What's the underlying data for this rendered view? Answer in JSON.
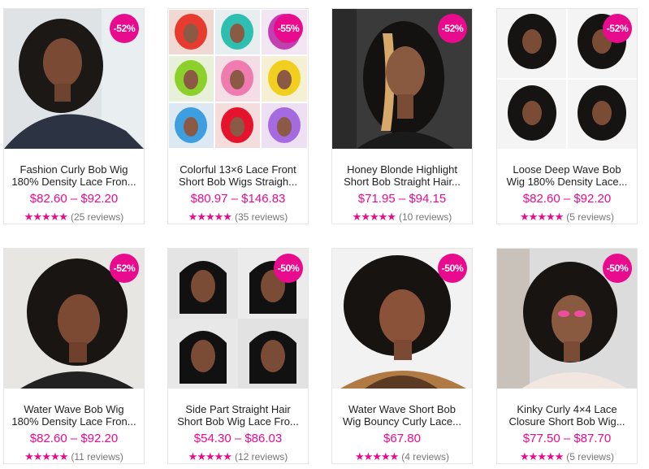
{
  "products": [
    {
      "title_line1": "Fashion Curly Bob Wig",
      "title_line2": "180% Density Lace Fron...",
      "price": "$82.60 – $92.20",
      "discount": "-52%",
      "stars": "★★★★★",
      "reviews": "(25 reviews)"
    },
    {
      "title_line1": "Colorful 13×6 Lace Front",
      "title_line2": "Short Bob Wigs Straigh...",
      "price": "$80.97 – $146.83",
      "discount": "-55%",
      "stars": "★★★★★",
      "reviews": "(35 reviews)"
    },
    {
      "title_line1": "Honey Blonde Highlight",
      "title_line2": "Short Bob Straight Hair...",
      "price": "$71.95 – $94.15",
      "discount": "-52%",
      "stars": "★★★★★",
      "reviews": "(10 reviews)"
    },
    {
      "title_line1": "Loose Deep Wave Bob",
      "title_line2": "Wig 180% Density Lace...",
      "price": "$82.60 – $92.20",
      "discount": "-52%",
      "stars": "★★★★★",
      "reviews": "(5 reviews)"
    },
    {
      "title_line1": "Water Wave Bob Wig",
      "title_line2": "180% Density Lace Fron...",
      "price": "$82.60 – $92.20",
      "discount": "-52%",
      "stars": "★★★★★",
      "reviews": "(11 reviews)"
    },
    {
      "title_line1": "Side Part Straight Hair",
      "title_line2": "Short Bob Wig Lace Fro...",
      "price": "$54.30 – $86.03",
      "discount": "-50%",
      "stars": "★★★★★",
      "reviews": "(12 reviews)"
    },
    {
      "title_line1": "Water Wave Short Bob",
      "title_line2": "Wig Bouncy Curly Lace...",
      "price": "$67.80",
      "discount": "-50%",
      "stars": "★★★★★",
      "reviews": "(4 reviews)"
    },
    {
      "title_line1": "Kinky Curly 4×4 Lace",
      "title_line2": "Closure Short Bob Wig...",
      "price": "$77.50 – $87.70",
      "discount": "-50%",
      "stars": "★★★★★",
      "reviews": "(5 reviews)"
    }
  ],
  "colors": {
    "accent": "#e90b8d",
    "border": "#e6e6e6",
    "text": "#222222",
    "muted": "#777777"
  }
}
